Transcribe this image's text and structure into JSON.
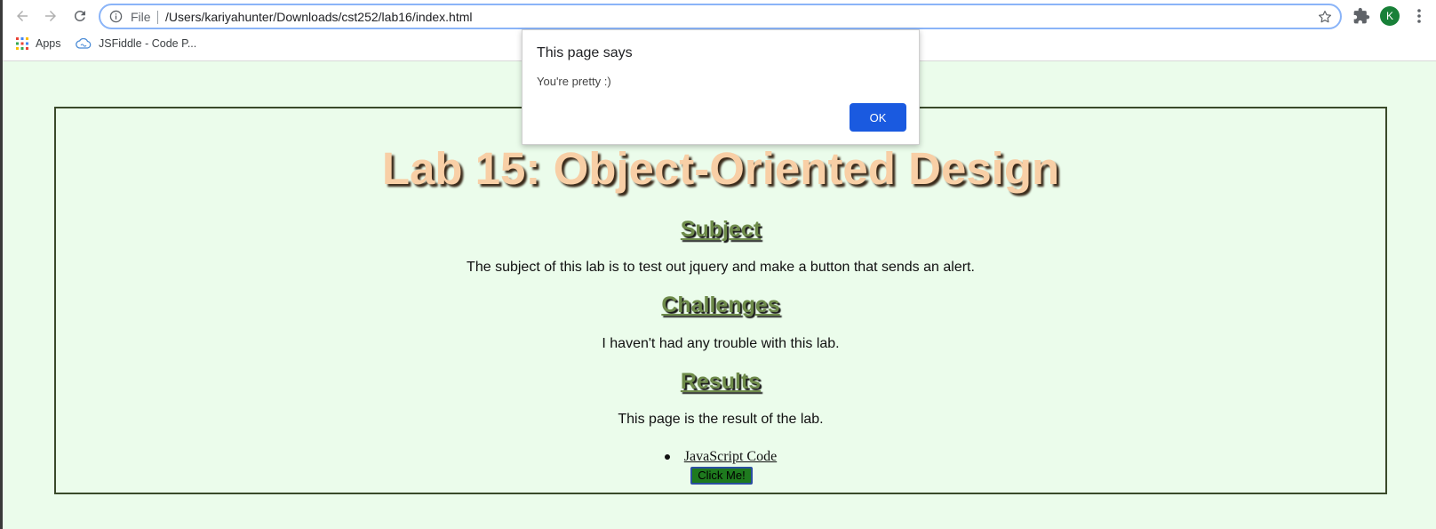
{
  "browser": {
    "scheme_label": "File",
    "url": "/Users/kariyahunter/Downloads/cst252/lab16/index.html",
    "profile_initial": "K",
    "bookmarks": [
      {
        "label": "Apps",
        "icon": "apps-grid-icon"
      },
      {
        "label": "JSFiddle - Code P...",
        "icon": "jsfiddle-cloud-icon"
      }
    ]
  },
  "page": {
    "title": "Lab 15: Object-Oriented Design",
    "sections": [
      {
        "heading": "Subject",
        "text": "The subject of this lab is to test out jquery and make a button that sends an alert."
      },
      {
        "heading": "Challenges",
        "text": "I haven't had any trouble with this lab."
      },
      {
        "heading": "Results",
        "text": "This page is the result of the lab."
      }
    ],
    "links": [
      {
        "label": "JavaScript Code"
      }
    ],
    "button_label": "Click Me!"
  },
  "dialog": {
    "title": "This page says",
    "message": "You're pretty :)",
    "ok_label": "OK"
  },
  "colors": {
    "page_background": "#ebfceb",
    "title_color": "#f8cfa6",
    "heading_color": "#6e8b4a",
    "button_green": "#1e7a1e",
    "dialog_ok_blue": "#1a5ae0"
  }
}
